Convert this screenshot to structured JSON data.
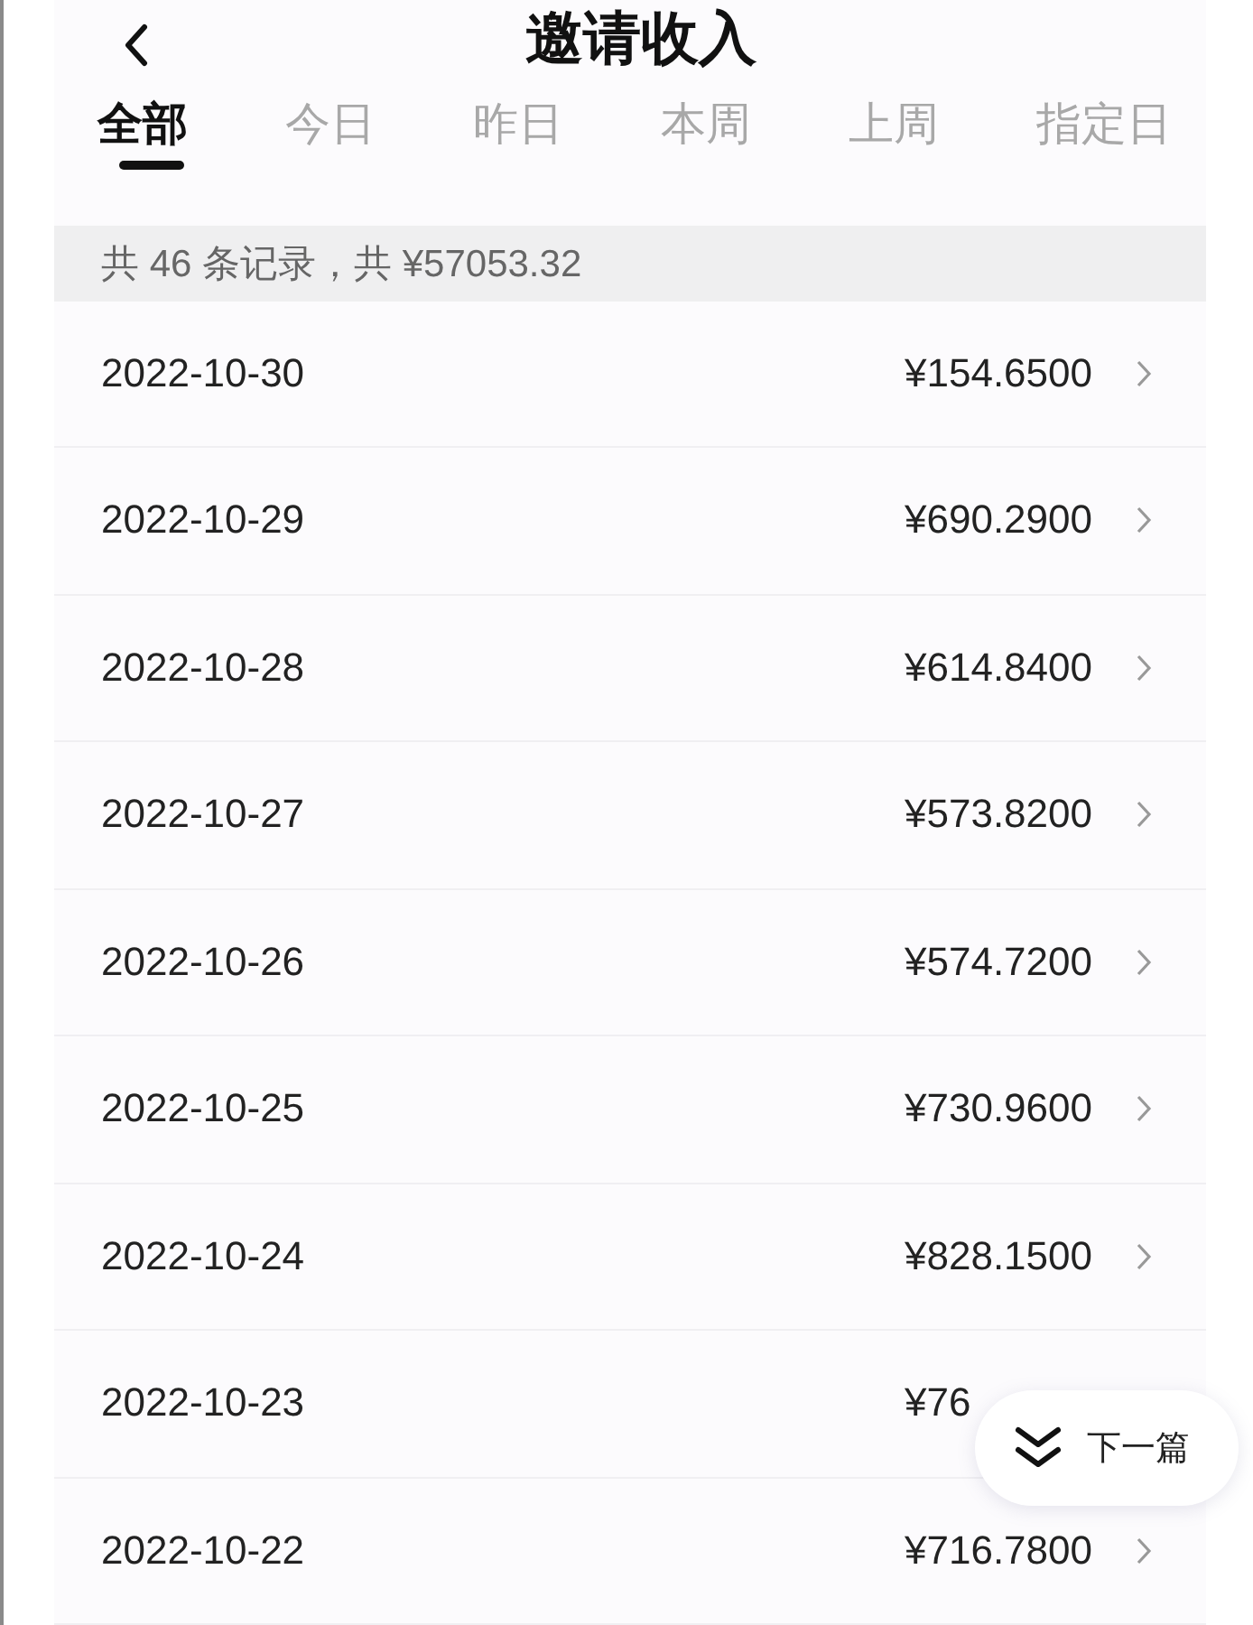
{
  "header": {
    "title": "邀请收入"
  },
  "tabs": [
    {
      "label": "全部",
      "selected": true
    },
    {
      "label": "今日",
      "selected": false
    },
    {
      "label": "昨日",
      "selected": false
    },
    {
      "label": "本周",
      "selected": false
    },
    {
      "label": "上周",
      "selected": false
    },
    {
      "label": "指定日",
      "selected": false
    }
  ],
  "summary": "共 46 条记录，共 ¥57053.32",
  "records": [
    {
      "date": "2022-10-30",
      "amount": "¥154.6500"
    },
    {
      "date": "2022-10-29",
      "amount": "¥690.2900"
    },
    {
      "date": "2022-10-28",
      "amount": "¥614.8400"
    },
    {
      "date": "2022-10-27",
      "amount": "¥573.8200"
    },
    {
      "date": "2022-10-26",
      "amount": "¥574.7200"
    },
    {
      "date": "2022-10-25",
      "amount": "¥730.9600"
    },
    {
      "date": "2022-10-24",
      "amount": "¥828.1500"
    },
    {
      "date": "2022-10-23",
      "amount": "¥76",
      "covered": true
    },
    {
      "date": "2022-10-22",
      "amount": "¥716.7800"
    }
  ],
  "next_button": "下一篇"
}
